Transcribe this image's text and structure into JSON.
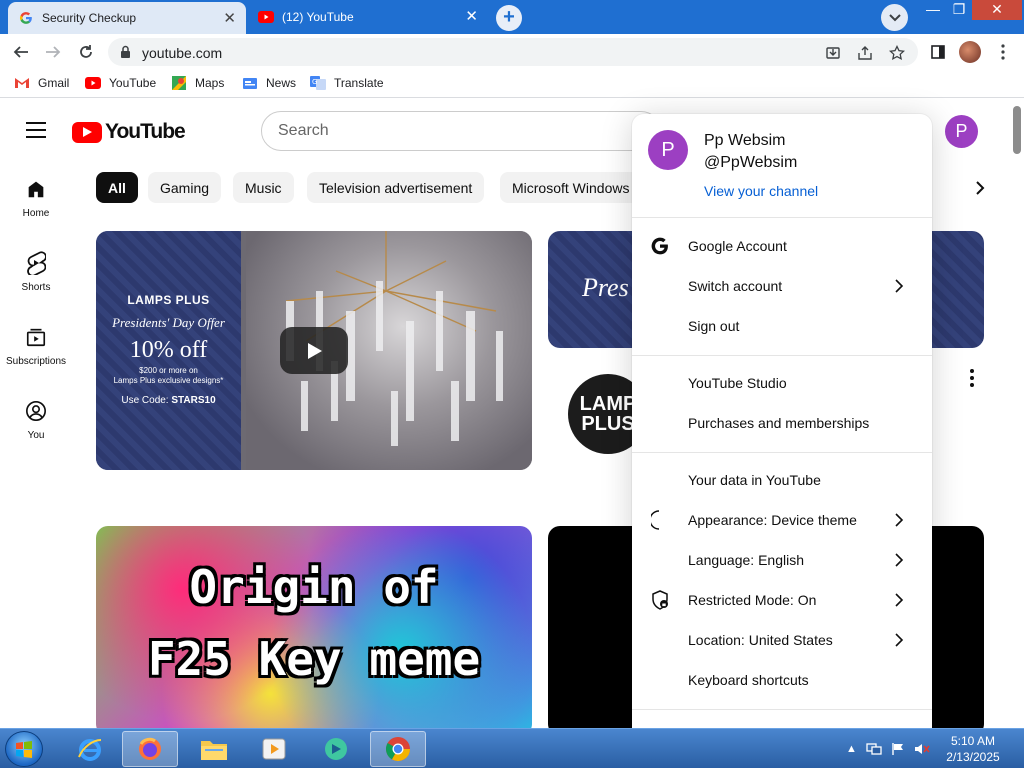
{
  "browser": {
    "tabs": [
      {
        "title": "Security Checkup",
        "active": false
      },
      {
        "title": "(12) YouTube",
        "active": true
      }
    ],
    "new_tab_label": "+",
    "window_controls": {
      "minimize": "—",
      "maximize": "❐",
      "close": "✕"
    },
    "url": "youtube.com",
    "bookmarks": [
      {
        "label": "Gmail",
        "icon": "gmail-icon"
      },
      {
        "label": "YouTube",
        "icon": "youtube-icon"
      },
      {
        "label": "Maps",
        "icon": "maps-icon"
      },
      {
        "label": "News",
        "icon": "news-icon"
      },
      {
        "label": "Translate",
        "icon": "translate-icon"
      }
    ]
  },
  "youtube": {
    "logo_text": "YouTube",
    "search_placeholder": "Search",
    "avatar_letter": "P",
    "sidenav": [
      {
        "label": "Home",
        "icon": "home-icon"
      },
      {
        "label": "Shorts",
        "icon": "shorts-icon"
      },
      {
        "label": "Subscriptions",
        "icon": "subscriptions-icon"
      },
      {
        "label": "You",
        "icon": "you-icon"
      }
    ],
    "chips": [
      "All",
      "Gaming",
      "Music",
      "Television advertisement",
      "Microsoft Windows"
    ],
    "videos": {
      "lamps_ad": {
        "brand": "LAMPS PLUS",
        "headline": "Presidents' Day Offer",
        "discount": "10% off",
        "fine_print_1": "$200 or more on",
        "fine_print_2": "Lamps Plus exclusive designs*",
        "code_prefix": "Use Code: ",
        "code": "STARS10"
      },
      "second_thumb_text": "Pres",
      "channel_logo_line1": "LAMP",
      "channel_logo_line2": "PLUS",
      "meme_line1": "Origin of",
      "meme_line2": "F25 Key meme"
    }
  },
  "account_menu": {
    "avatar_letter": "P",
    "name": "Pp Websim",
    "handle": "@PpWebsim",
    "view_channel": "View your channel",
    "items": [
      {
        "label": "Google Account",
        "icon": "google-icon",
        "arrow": false
      },
      {
        "label": "Switch account",
        "icon": "switch-account-icon",
        "arrow": true
      },
      {
        "label": "Sign out",
        "icon": "sign-out-icon",
        "arrow": false
      },
      {
        "label": "YouTube Studio",
        "icon": "studio-icon",
        "arrow": false
      },
      {
        "label": "Purchases and memberships",
        "icon": "purchases-icon",
        "arrow": false
      },
      {
        "label": "Your data in YouTube",
        "icon": "your-data-icon",
        "arrow": false
      },
      {
        "label": "Appearance: Device theme",
        "icon": "moon-icon",
        "arrow": true
      },
      {
        "label": "Language: English",
        "icon": "language-icon",
        "arrow": true
      },
      {
        "label": "Restricted Mode: On",
        "icon": "restricted-mode-icon",
        "arrow": true
      },
      {
        "label": "Location: United States",
        "icon": "location-icon",
        "arrow": true
      },
      {
        "label": "Keyboard shortcuts",
        "icon": "keyboard-icon",
        "arrow": false
      }
    ]
  },
  "taskbar": {
    "apps": [
      "internet-explorer-icon",
      "firefox-icon",
      "file-explorer-icon",
      "media-player-icon",
      "app-icon",
      "chrome-icon"
    ],
    "time": "5:10 AM",
    "date": "2/13/2025"
  },
  "colors": {
    "youtube_red": "#ff0000",
    "avatar_purple": "#9c3fc2",
    "link_blue": "#065fd4",
    "chrome_blue": "#1f6fd1"
  }
}
